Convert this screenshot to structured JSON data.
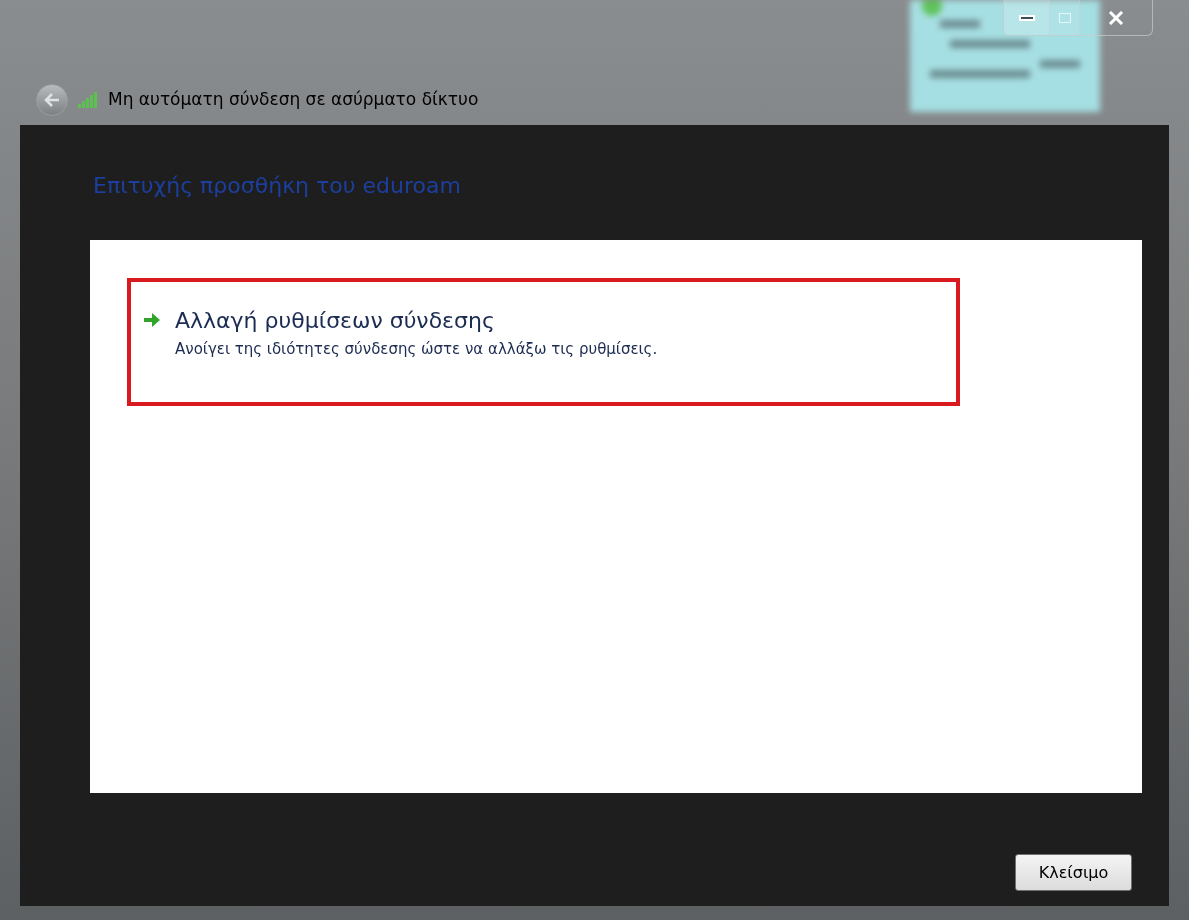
{
  "window": {
    "title": "Μη αυτόματη σύνδεση σε ασύρματο δίκτυο"
  },
  "heading": "Επιτυχής προσθήκη του eduroam",
  "links": [
    {
      "title": "Αλλαγή ρυθμίσεων σύνδεσης",
      "description": "Ανοίγει της ιδιότητες σύνδεσης ώστε να αλλάξω τις ρυθμίσεις.",
      "highlighted": true
    }
  ],
  "buttons": [
    "Κλείσιμο"
  ]
}
